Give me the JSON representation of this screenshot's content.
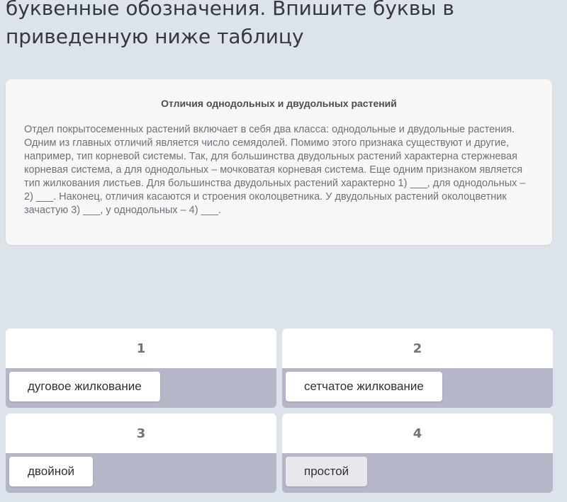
{
  "task": {
    "heading": "буквенные обозначения. Впишите буквы в приведенную ниже таблицу"
  },
  "text_card": {
    "title": "Отличия однодольных и двудольных растений",
    "body": "Отдел покрытосеменных растений включает в себя два класса: однодольные и двудольные растения. Одним из главных отличий является число семядолей. Помимо этого признака существуют и другие, например, тип корневой системы. Так, для большинства двудольных растений характерна стержневая корневая система, а для однодольных – мочковатая корневая система. Еще одним признаком является тип жилкования листьев. Для большинства двудольных растений характерно 1) ___, для однодольных – 2) ___. Наконец, отличия касаются и строения околоцветника. У двудольных растений околоцветник зачастую 3) ___, у однодольных – 4) ___."
  },
  "answer_table": {
    "cells": [
      {
        "number": "1",
        "answer": "дуговое жилкование"
      },
      {
        "number": "2",
        "answer": "сетчатое жилкование"
      },
      {
        "number": "3",
        "answer": "двойной"
      },
      {
        "number": "4",
        "answer": "простой"
      }
    ]
  },
  "colors": {
    "background": "#dde3ea",
    "drop_zone": "#b6b6c9",
    "card": "#f7f7f7"
  }
}
